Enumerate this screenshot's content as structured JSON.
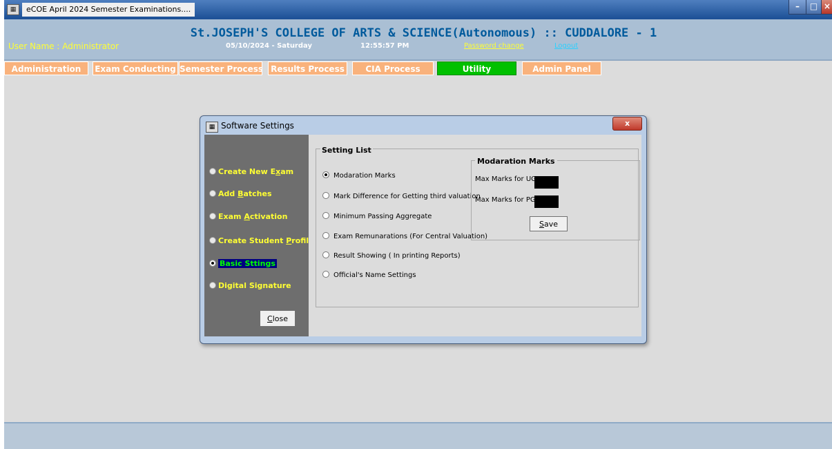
{
  "window": {
    "app_icon": "eCOE-app-icon",
    "title": "eCOE   April 2024 Semester Examinations....",
    "controls": [
      "minimize",
      "maximize",
      "close"
    ]
  },
  "header": {
    "college": "St.JOSEPH'S COLLEGE OF ARTS & SCIENCE(Autonomous) :: CUDDALORE - 1",
    "user": "User Name : Administrator",
    "date": "05/10/2024 - Saturday",
    "time": "12:55:57 PM",
    "password_change": "Password change",
    "logout": "Logout"
  },
  "menu": {
    "items": [
      {
        "label": "Administration"
      },
      {
        "label": "Exam Conducting"
      },
      {
        "label": "Semester Process"
      },
      {
        "label": "Results Process"
      },
      {
        "label": "CIA Process"
      },
      {
        "label": "Utility",
        "active": true
      },
      {
        "label": "Admin Panel"
      }
    ]
  },
  "dialog": {
    "title": "Software Settings",
    "close_x": "x",
    "left_options": [
      {
        "label": "Create New Exam",
        "access_key": "x"
      },
      {
        "label": "Add Batches",
        "access_key": "B"
      },
      {
        "label": "Exam Activation",
        "access_key": "A"
      },
      {
        "label": "Create Student Profile",
        "access_key": "P"
      },
      {
        "label": "Basic Sttings",
        "selected": true
      },
      {
        "label": "Digital Signature"
      }
    ],
    "close_button": "Close",
    "setting_list": {
      "legend": "Setting List",
      "options": [
        {
          "label": "Modaration Marks",
          "checked": true
        },
        {
          "label": "Mark Difference for Getting third valuation"
        },
        {
          "label": "Minimum Passing Aggregate"
        },
        {
          "label": "Exam Remunarations (For Central Valuation)"
        },
        {
          "label": "Result Showing ( In printing Reports)"
        },
        {
          "label": "Official's Name Settings"
        }
      ]
    },
    "moderation": {
      "legend": "Modaration Marks",
      "ug_label": "Max Marks for UG",
      "pg_label": "Max Marks for PG",
      "ug_value": "",
      "pg_value": "",
      "save_button": "Save"
    }
  }
}
